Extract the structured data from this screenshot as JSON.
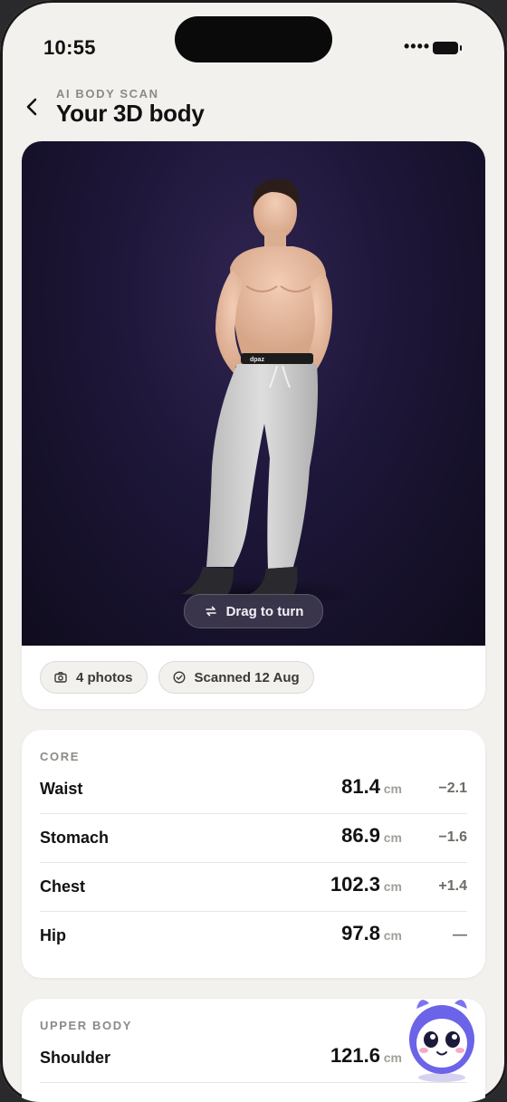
{
  "status_bar": {
    "time": "10:55",
    "signal": "••••"
  },
  "header": {
    "eyebrow": "AI BODY SCAN",
    "title": "Your 3D body"
  },
  "viewer": {
    "drag_label": "Drag to turn",
    "waistband_text": "dpaz"
  },
  "chips": [
    {
      "icon": "camera-icon",
      "label": "4 photos"
    },
    {
      "icon": "check-circle-icon",
      "label": "Scanned 12 Aug"
    }
  ],
  "sections": {
    "core": {
      "label": "CORE",
      "rows": [
        {
          "name": "Waist",
          "value": "81.4",
          "unit": "cm",
          "delta": "−2.1"
        },
        {
          "name": "Stomach",
          "value": "86.9",
          "unit": "cm",
          "delta": "−1.6"
        },
        {
          "name": "Chest",
          "value": "102.3",
          "unit": "cm",
          "delta": "+1.4"
        },
        {
          "name": "Hip",
          "value": "97.8",
          "unit": "cm",
          "delta": "—"
        }
      ]
    },
    "upper_body": {
      "label": "UPPER BODY",
      "rows": [
        {
          "name": "Shoulder",
          "value": "121.6",
          "unit": "cm",
          "delta": ""
        }
      ]
    }
  },
  "colors": {
    "background": "#f2f1ee",
    "viewer_bg": "#1d1638",
    "text": "#121212",
    "muted": "#8c8a86",
    "mascot": "#6b63e8"
  }
}
